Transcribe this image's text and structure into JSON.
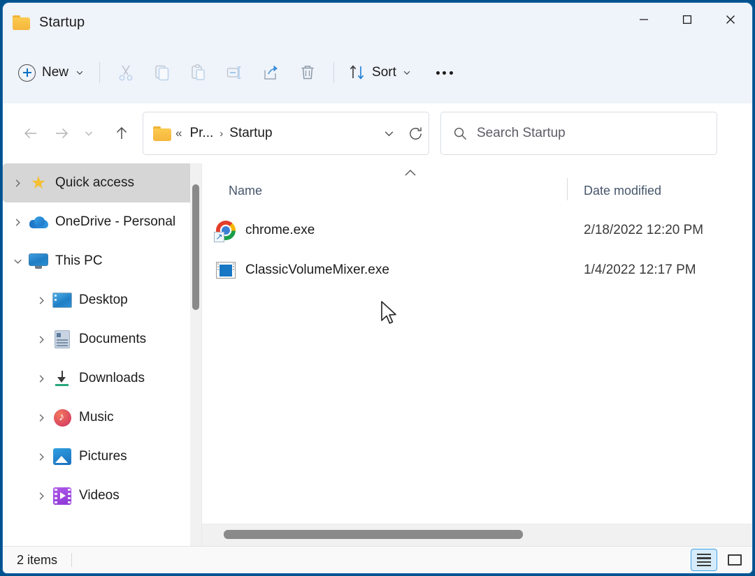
{
  "window": {
    "title": "Startup",
    "folder_icon": "folder-icon",
    "controls": {
      "minimize": "minimize-icon",
      "maximize": "maximize-icon",
      "close": "close-icon"
    }
  },
  "toolbar": {
    "new_label": "New",
    "new_dropdown": "chevron-down-icon",
    "cut_label": "cut-icon",
    "copy_label": "copy-icon",
    "paste_label": "paste-icon",
    "rename_label": "rename-icon",
    "share_label": "share-icon",
    "delete_label": "delete-icon",
    "sort_label": "Sort",
    "sort_dropdown": "chevron-down-icon",
    "more_label": "see-more-icon"
  },
  "navigation": {
    "back": "arrow-left-icon",
    "forward": "arrow-right-icon",
    "recent": "chevron-down-icon",
    "up": "arrow-up-icon"
  },
  "breadcrumb": {
    "folder_icon": "folder-icon",
    "overflow": "«",
    "segments": [
      "Pr...",
      "Startup"
    ],
    "separator": "›",
    "dropdown": "chevron-down-icon",
    "refresh": "refresh-icon"
  },
  "search": {
    "icon": "search-icon",
    "placeholder": "Search Startup",
    "value": ""
  },
  "sidebar": {
    "items": [
      {
        "label": "Quick access",
        "icon": "star-icon",
        "expanded": false,
        "selected": true,
        "indent": 0
      },
      {
        "label": "OneDrive - Personal",
        "icon": "cloud-icon",
        "expanded": false,
        "selected": false,
        "indent": 0
      },
      {
        "label": "This PC",
        "icon": "computer-icon",
        "expanded": true,
        "selected": false,
        "indent": 0
      },
      {
        "label": "Desktop",
        "icon": "desktop-icon",
        "expanded": false,
        "selected": false,
        "indent": 1
      },
      {
        "label": "Documents",
        "icon": "documents-icon",
        "expanded": false,
        "selected": false,
        "indent": 1
      },
      {
        "label": "Downloads",
        "icon": "downloads-icon",
        "expanded": false,
        "selected": false,
        "indent": 1
      },
      {
        "label": "Music",
        "icon": "music-icon",
        "expanded": false,
        "selected": false,
        "indent": 1
      },
      {
        "label": "Pictures",
        "icon": "pictures-icon",
        "expanded": false,
        "selected": false,
        "indent": 1
      },
      {
        "label": "Videos",
        "icon": "videos-icon",
        "expanded": false,
        "selected": false,
        "indent": 1
      }
    ]
  },
  "filelist": {
    "columns": [
      "Name",
      "Date modified"
    ],
    "sort_column": "Name",
    "sort_direction": "ascending",
    "sort_indicator": "chevron-up-icon",
    "rows": [
      {
        "name": "chrome.exe",
        "date_modified": "2/18/2022 12:20 PM",
        "icon": "chrome-shortcut-icon"
      },
      {
        "name": "ClassicVolumeMixer.exe",
        "date_modified": "1/4/2022 12:17 PM",
        "icon": "application-window-icon"
      }
    ]
  },
  "statusbar": {
    "item_count": "2 items",
    "view_details": "details-view-icon",
    "view_large_icons": "large-icons-view-icon",
    "active_view": "details"
  },
  "colors": {
    "accent": "#0b6fc4",
    "titlebar_bg": "#eff3fa",
    "window_bg": "#ffffff",
    "selection_bg": "#d6d6d6",
    "desktop_bg": "#00528f",
    "folder_yellow": "#f5b63c"
  }
}
